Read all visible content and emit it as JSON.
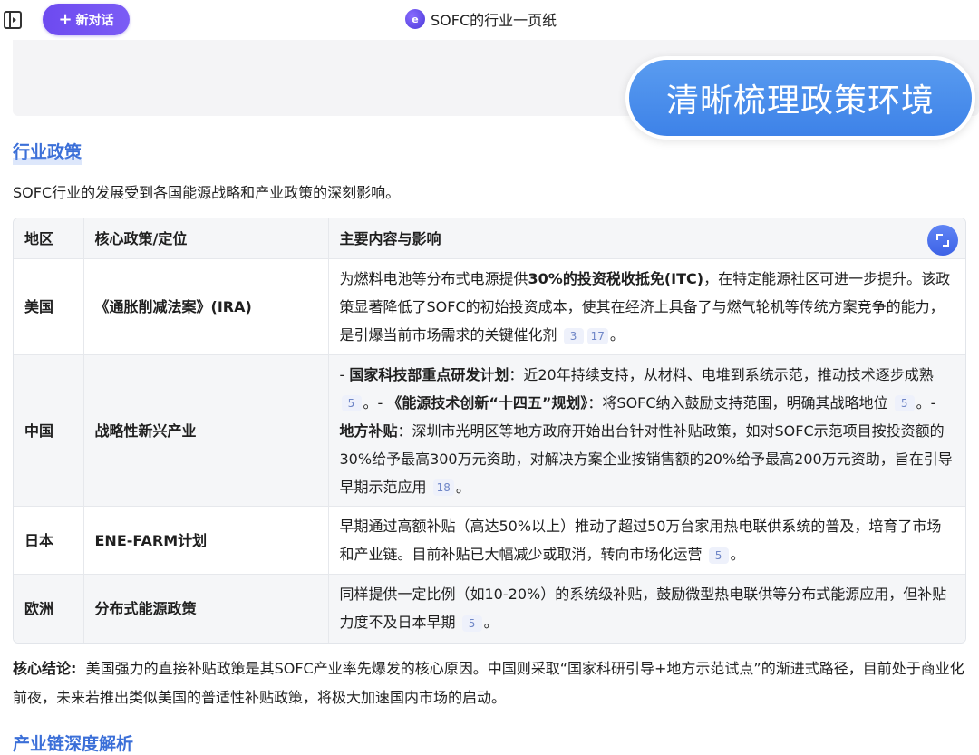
{
  "header": {
    "new_chat_label": "新对话",
    "title": "SOFC的行业一页纸",
    "title_icon": "e"
  },
  "overlay": {
    "text": "清晰梳理政策环境"
  },
  "section": {
    "title": "行业政策",
    "intro": "SOFC行业的发展受到各国能源战略和产业政策的深刻影响。"
  },
  "table": {
    "headers": [
      "地区",
      "核心政策/定位",
      "主要内容与影响"
    ],
    "rows": [
      {
        "region": "美国",
        "policy": "《通胀削减法案》(IRA)",
        "desc_1": "为燃料电池等分布式电源提供",
        "desc_bold_1": "30%的投资税收抵免(ITC)",
        "desc_2": "，在特定能源社区可进一步提升。该政策显著降低了SOFC的初始投资成本，使其在经济上具备了与燃气轮机等传统方案竞争的能力，是引爆当前市场需求的关键催化剂",
        "refs": [
          "3",
          "17"
        ],
        "desc_end": "。"
      },
      {
        "region": "中国",
        "policy": "战略性新兴产业",
        "p1_prefix": "- ",
        "p1_bold": "国家科技部重点研发计划",
        "p1_text": "：近20年持续支持，从材料、电堆到系统示范，推动技术逐步成熟",
        "p1_ref": "5",
        "p2_prefix": "。- ",
        "p2_bold": "《能源技术创新“十四五”规划》",
        "p2_text": "：将SOFC纳入鼓励支持范围，明确其战略地位",
        "p2_ref": "5",
        "p3_prefix": "。- ",
        "p3_bold": "地方补贴",
        "p3_text": "：深圳市光明区等地方政府开始出台针对性补贴政策，如对SOFC示范项目按投资额的30%给予最高300万元资助，对解决方案企业按销售额的20%给予最高200万元资助，旨在引导早期示范应用",
        "p3_ref": "18",
        "desc_end": "。"
      },
      {
        "region": "日本",
        "policy": "ENE-FARM计划",
        "desc": "早期通过高额补贴（高达50%以上）推动了超过50万台家用热电联供系统的普及，培育了市场和产业链。目前补贴已大幅减少或取消，转向市场化运营",
        "ref": "5",
        "desc_end": "。"
      },
      {
        "region": "欧洲",
        "policy": "分布式能源政策",
        "desc": "同样提供一定比例（如10-20%）的系统级补贴，鼓励微型热电联供等分布式能源应用，但补贴力度不及日本早期",
        "ref": "5",
        "desc_end": "。"
      }
    ]
  },
  "conclusion": {
    "label": "核心结论:",
    "text": "美国强力的直接补贴政策是其SOFC产业率先爆发的核心原因。中国则采取“国家科研引导+地方示范试点”的渐进式路径，目前处于商业化前夜，未来若推出类似美国的普适性补贴政策，将极大加速国内市场的启动。"
  },
  "next_section": {
    "title": "产业链深度解析"
  }
}
